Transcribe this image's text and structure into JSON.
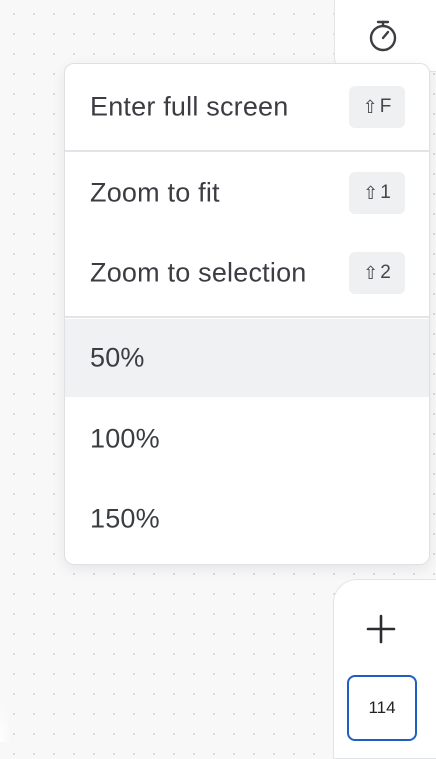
{
  "toolbar": {
    "timer_icon": "stopwatch-icon"
  },
  "menu": {
    "items": [
      {
        "label": "Enter full screen",
        "shortcut_key": "F",
        "shortcut_modifier": "⇧"
      },
      {
        "label": "Zoom to fit",
        "shortcut_key": "1",
        "shortcut_modifier": "⇧"
      },
      {
        "label": "Zoom to selection",
        "shortcut_key": "2",
        "shortcut_modifier": "⇧"
      },
      {
        "label": "50%",
        "active": true
      },
      {
        "label": "100%"
      },
      {
        "label": "150%"
      }
    ]
  },
  "zoom_panel": {
    "plus_icon": "plus-icon",
    "value": "114"
  },
  "colors": {
    "accent": "#1f5fbf",
    "active_row": "#f0f1f3",
    "text": "#3b3d42"
  }
}
